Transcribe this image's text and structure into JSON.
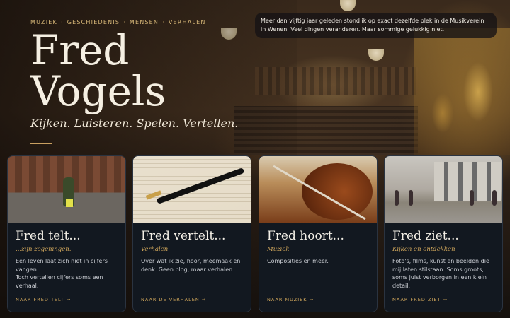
{
  "nav": [
    "MUZIEK",
    "GESCHIEDENIS",
    "MENSEN",
    "VERHALEN"
  ],
  "nav_separator": "·",
  "title_line1": "Fred",
  "title_line2": "Vogels",
  "tagline": "Kijken. Luisteren. Spelen. Vertellen.",
  "quote": "Meer dan vijftig jaar geleden stond ik op exact dezelfde plek in de Musikverein in Wenen. Veel dingen veranderen. Maar sommige gelukkig niet.",
  "cards": [
    {
      "title": "Fred telt...",
      "subtitle": "...zijn zegeningen.",
      "desc_line1": "Een leven laat zich niet in cijfers vangen.",
      "desc_line2": "Toch vertellen cijfers soms een verhaal.",
      "link": "NAAR FRED TELT →"
    },
    {
      "title": "Fred vertelt...",
      "subtitle": "Verhalen",
      "desc_line1": "Over wat ik zie, hoor, meemaak en denk. Geen blog, maar verhalen.",
      "desc_line2": "",
      "link": "NAAR DE VERHALEN →"
    },
    {
      "title": "Fred hoort...",
      "subtitle": "Muziek",
      "desc_line1": "Composities en meer.",
      "desc_line2": "",
      "link": "NAAR MUZIEK →"
    },
    {
      "title": "Fred ziet...",
      "subtitle": "Kijken en ontdekken",
      "desc_line1": "Foto's, films, kunst en beelden die mij laten stilstaan. Soms groots, soms juist verborgen in een klein detail.",
      "desc_line2": "",
      "link": "NAAR FRED ZIET →"
    }
  ]
}
